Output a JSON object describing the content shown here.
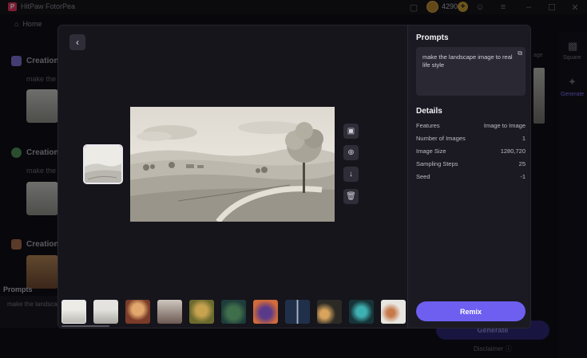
{
  "app": {
    "title": "HitPaw FotorPea",
    "credits": "4290",
    "home_label": "Home"
  },
  "background": {
    "sections": [
      {
        "title": "Creation",
        "sub": "make the"
      },
      {
        "title": "Creation",
        "sub": "make the"
      },
      {
        "title": "Creation"
      }
    ],
    "prompts_label": "Prompts",
    "prompt_preview": "make the landscap",
    "sidebar": {
      "square_label": "Square",
      "generate_label": "Generate",
      "age_fragment": "age"
    },
    "generate_button": "Generate",
    "disclaimer": "Disclaimer"
  },
  "modal": {
    "prompts_title": "Prompts",
    "prompt_text": "make the landscape image to real life style",
    "details_title": "Details",
    "details": [
      {
        "label": "Features",
        "value": "Image to Image"
      },
      {
        "label": "Number of Images",
        "value": "1"
      },
      {
        "label": "Image Size",
        "value": "1280,720"
      },
      {
        "label": "Sampling Steps",
        "value": "25"
      },
      {
        "label": "Seed",
        "value": "-1"
      }
    ],
    "remix_label": "Remix"
  },
  "colors": {
    "accent": "#6e5ff0",
    "background": "#0f0e14",
    "modal": "#17161e",
    "panel": "#1b1a22"
  }
}
